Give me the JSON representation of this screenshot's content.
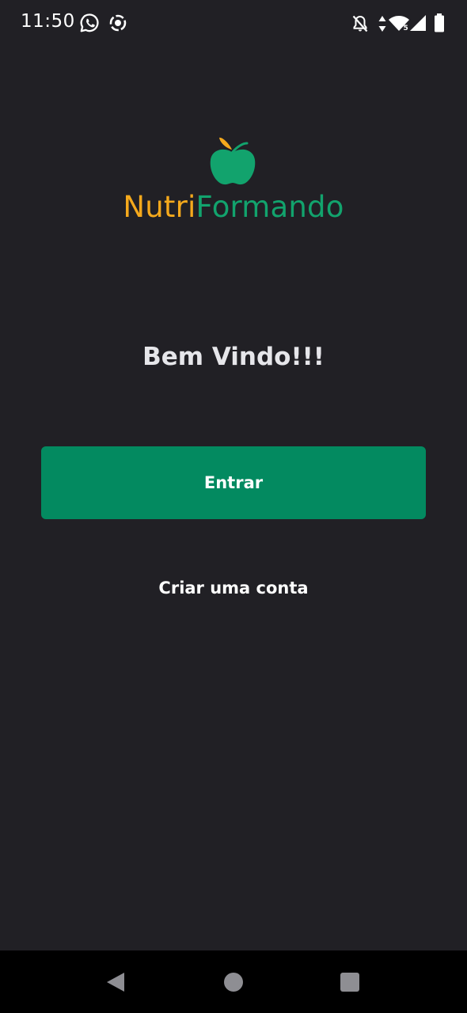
{
  "status_bar": {
    "time": "11:50",
    "left_icons": [
      "whatsapp-icon",
      "screen-record-icon"
    ],
    "right_icons": [
      "notifications-off-icon",
      "data-arrows-icon",
      "wifi-icon",
      "signal-icon",
      "battery-icon"
    ],
    "wifi_badge": "5"
  },
  "logo": {
    "icon": "apple-icon",
    "name_part1": "Nutri",
    "name_part2": "Formando",
    "colors": {
      "nutri": "#f5a91c",
      "formando": "#12a36d",
      "apple": "#12a36d",
      "leaf": "#f5a91c"
    }
  },
  "welcome": {
    "title": "Bem Vindo!!!"
  },
  "actions": {
    "login_label": "Entrar",
    "create_account_label": "Criar uma conta"
  },
  "theme": {
    "background": "#212025",
    "primary_button": "#038a60",
    "nav_bar": "#000000"
  },
  "nav_bar": {
    "buttons": [
      "back-icon",
      "home-icon",
      "recents-icon"
    ]
  }
}
